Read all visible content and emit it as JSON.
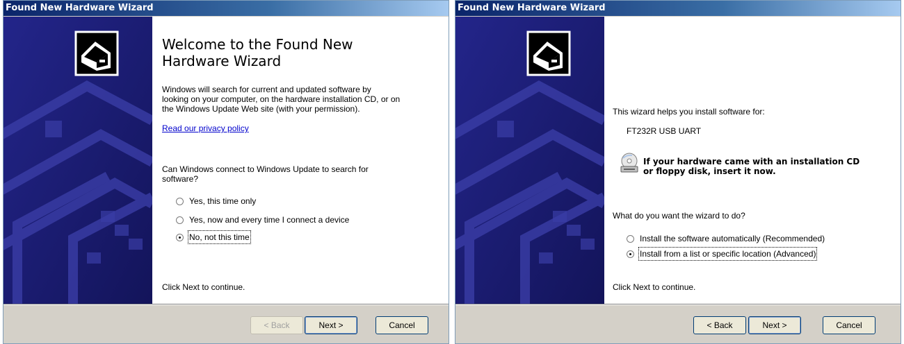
{
  "left_wizard": {
    "title": "Found New Hardware Wizard",
    "heading_line1": "Welcome to the Found New",
    "heading_line2": "Hardware Wizard",
    "intro_line1": "Windows will search for current and updated software by",
    "intro_line2": "looking on your computer, on the hardware installation CD, or on",
    "intro_line3": "the Windows Update Web site (with your permission).",
    "privacy_link": "Read our privacy policy",
    "question_line1": "Can Windows connect to Windows Update to search for",
    "question_line2": "software?",
    "options": [
      {
        "label": "Yes, this time only",
        "selected": false
      },
      {
        "label": "Yes, now and every time I connect a device",
        "selected": false
      },
      {
        "label": "No, not this time",
        "selected": true
      }
    ],
    "footer_text": "Click Next to continue.",
    "buttons": {
      "back": "< Back",
      "next": "Next >",
      "cancel": "Cancel"
    }
  },
  "right_wizard": {
    "title": "Found New Hardware Wizard",
    "help_text": "This wizard helps you install software for:",
    "device_name": "FT232R USB UART",
    "cd_text_line1": "If your hardware came with an installation CD",
    "cd_text_line2": "or floppy disk, insert it now.",
    "question": "What do you want the wizard to do?",
    "options": [
      {
        "label": "Install the software automatically (Recommended)",
        "selected": false
      },
      {
        "label": "Install from a list or specific location (Advanced)",
        "selected": true
      }
    ],
    "footer_text": "Click Next to continue.",
    "buttons": {
      "back": "< Back",
      "next": "Next >",
      "cancel": "Cancel"
    }
  },
  "icons": {
    "sidebar": "hardware-box-icon",
    "cd": "cd-drive-icon"
  },
  "colors": {
    "title_bar": "#0a246a",
    "sidebar": "#1d1f7a",
    "link": "#0000cc",
    "dialog_face": "#d4d0c8"
  }
}
